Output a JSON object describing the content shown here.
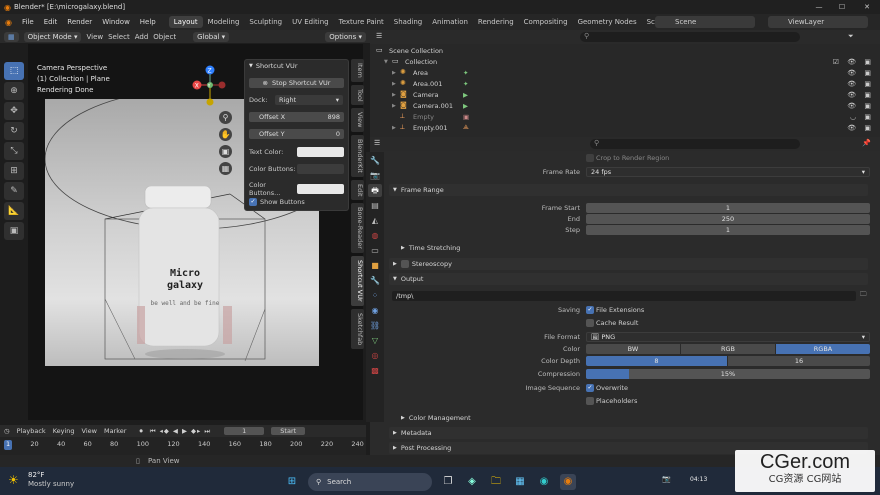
{
  "window": {
    "title": "Blender* [E:\\microgalaxy.blend]",
    "min": "—",
    "max": "☐",
    "close": "✕"
  },
  "menu": {
    "items": [
      "File",
      "Edit",
      "Render",
      "Window",
      "Help"
    ]
  },
  "workspaces": [
    "Layout",
    "Modeling",
    "Sculpting",
    "UV Editing",
    "Texture Paint",
    "Shading",
    "Animation",
    "Rendering",
    "Compositing",
    "Geometry Nodes",
    "Scripting"
  ],
  "scene": {
    "name": "Scene",
    "view_layer": "ViewLayer"
  },
  "viewport_header": {
    "mode": "Object Mode",
    "menus": [
      "View",
      "Select",
      "Add",
      "Object"
    ],
    "transform": "Global",
    "options": "Options"
  },
  "viewport": {
    "line1": "Camera Perspective",
    "line2": "(1) Collection | Plane",
    "line3": "Rendering Done"
  },
  "gizmo": {
    "z": "Z",
    "x": "X",
    "y": "Y"
  },
  "jar": {
    "brand_line1": "Micro",
    "brand_line2": "galaxy",
    "tag": "be well and be fine"
  },
  "shortcut_panel": {
    "title": "Shortcut VUr",
    "stop_button": "Stop Shortcut VUr",
    "dock_label": "Dock:",
    "dock_value": "Right",
    "offset_x_label": "Offset X",
    "offset_x_value": "898",
    "offset_y_label": "Offset Y",
    "offset_y_value": "0",
    "text_color_label": "Text Color:",
    "color_buttons_label": "Color Buttons:",
    "color_buttons2_label": "Color Buttons...",
    "show_buttons_label": "Show Buttons"
  },
  "n_tabs": [
    "Item",
    "Tool",
    "View",
    "BlenderKit",
    "Edit",
    "Bone-Reader",
    "Shortcut VUr",
    "Sketchfab"
  ],
  "outliner": {
    "root": "Scene Collection",
    "collection": "Collection",
    "items": [
      {
        "name": "Area",
        "icon": "light-icon",
        "color": "#e0a040"
      },
      {
        "name": "Area.001",
        "icon": "light-icon",
        "color": "#e0a040"
      },
      {
        "name": "Camera",
        "icon": "camera-icon",
        "color": "#7ec97e"
      },
      {
        "name": "Camera.001",
        "icon": "camera-icon",
        "color": "#7ec97e"
      },
      {
        "name": "Empty",
        "icon": "empty-icon",
        "color": "#e89a5a"
      },
      {
        "name": "Empty.001",
        "icon": "empty-icon",
        "color": "#e89a5a"
      }
    ]
  },
  "properties": {
    "crop_label": "Crop to Render Region",
    "frame_rate_label": "Frame Rate",
    "frame_rate_value": "24 fps",
    "frame_range_title": "Frame Range",
    "frame_start_label": "Frame Start",
    "frame_start_value": "1",
    "end_label": "End",
    "end_value": "250",
    "step_label": "Step",
    "step_value": "1",
    "time_stretching": "Time Stretching",
    "stereoscopy": "Stereoscopy",
    "output_title": "Output",
    "output_path": "/tmp\\",
    "saving_label": "Saving",
    "file_extensions": "File Extensions",
    "cache_result": "Cache Result",
    "file_format_label": "File Format",
    "file_format_value": "PNG",
    "color_label": "Color",
    "color_options": [
      "BW",
      "RGB",
      "RGBA"
    ],
    "color_depth_label": "Color Depth",
    "color_depth_options": [
      "8",
      "16"
    ],
    "compression_label": "Compression",
    "compression_value": "15%",
    "compression_fraction": 0.15,
    "image_sequence_label": "Image Sequence",
    "overwrite": "Overwrite",
    "placeholders": "Placeholders",
    "color_management": "Color Management",
    "metadata": "Metadata",
    "post_processing": "Post Processing"
  },
  "timeline": {
    "menus": [
      "Playback",
      "Keying",
      "View",
      "Marker"
    ],
    "current_frame": "1",
    "start_label": "Start",
    "frames": [
      "1",
      "20",
      "40",
      "60",
      "80",
      "100",
      "120",
      "140",
      "160",
      "180",
      "200",
      "220",
      "240"
    ]
  },
  "statusbar": {
    "pan": "Pan View"
  },
  "taskbar": {
    "temp": "82°F",
    "weather": "Mostly sunny",
    "search": "Search",
    "time": "04:13"
  },
  "watermark": {
    "line1": "CGer.com",
    "line2": "CG资源 CG网站"
  },
  "colors": {
    "accent": "#4772b3",
    "bg": "#1d1d1d"
  }
}
